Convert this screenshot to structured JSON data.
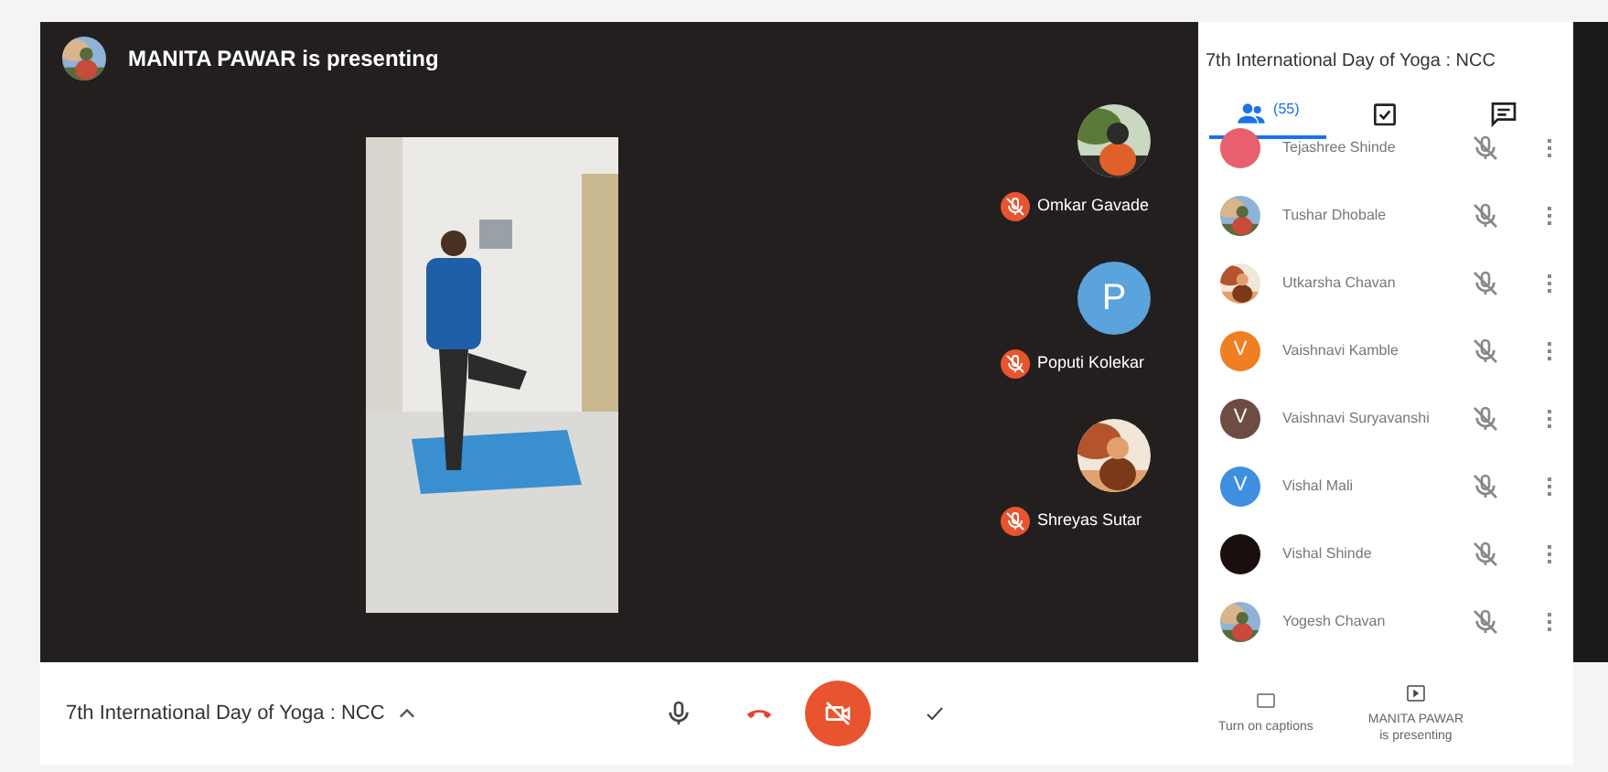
{
  "presenter_banner": {
    "text": "MANITA PAWAR is presenting"
  },
  "tiles": [
    {
      "name": "Omkar Gavade",
      "kind": "picture",
      "muted": true
    },
    {
      "name": "Poputi Kolekar",
      "kind": "letter",
      "letter": "P",
      "color": "#5ba3dc",
      "muted": true
    },
    {
      "name": "Shreyas Sutar",
      "kind": "picture",
      "muted": true
    }
  ],
  "sidebar": {
    "title": "7th International Day of Yoga : NCC",
    "tabs": [
      {
        "kind": "people",
        "count": "(55)",
        "selected": true
      },
      {
        "kind": "activities",
        "selected": false
      },
      {
        "kind": "chat",
        "selected": false
      }
    ],
    "participants": [
      {
        "name": "Tejashree Shinde",
        "kind": "letter",
        "color": "#e8606e",
        "muted": true
      },
      {
        "name": "Tushar Dhobale",
        "kind": "picture",
        "muted": true
      },
      {
        "name": "Utkarsha Chavan",
        "kind": "picture",
        "muted": true
      },
      {
        "name": "Vaishnavi Kamble",
        "kind": "letter",
        "letter": "V",
        "color": "#f07f22",
        "muted": true
      },
      {
        "name": "Vaishnavi Suryavanshi",
        "kind": "letter",
        "letter": "V",
        "color": "#6d4c41",
        "muted": true
      },
      {
        "name": "Vishal Mali",
        "kind": "letter",
        "letter": "V",
        "color": "#3f8fe0",
        "muted": true
      },
      {
        "name": "Vishal Shinde",
        "kind": "dark",
        "color": "#1a0f0f",
        "muted": true
      },
      {
        "name": "Yogesh Chavan",
        "kind": "picture",
        "muted": true
      }
    ]
  },
  "bottom_bar": {
    "meeting_title": "7th International Day of Yoga : NCC",
    "camera_off": true,
    "captions_label": "Turn on captions",
    "presenting_label": [
      "MANITA PAWAR",
      "is presenting"
    ]
  }
}
